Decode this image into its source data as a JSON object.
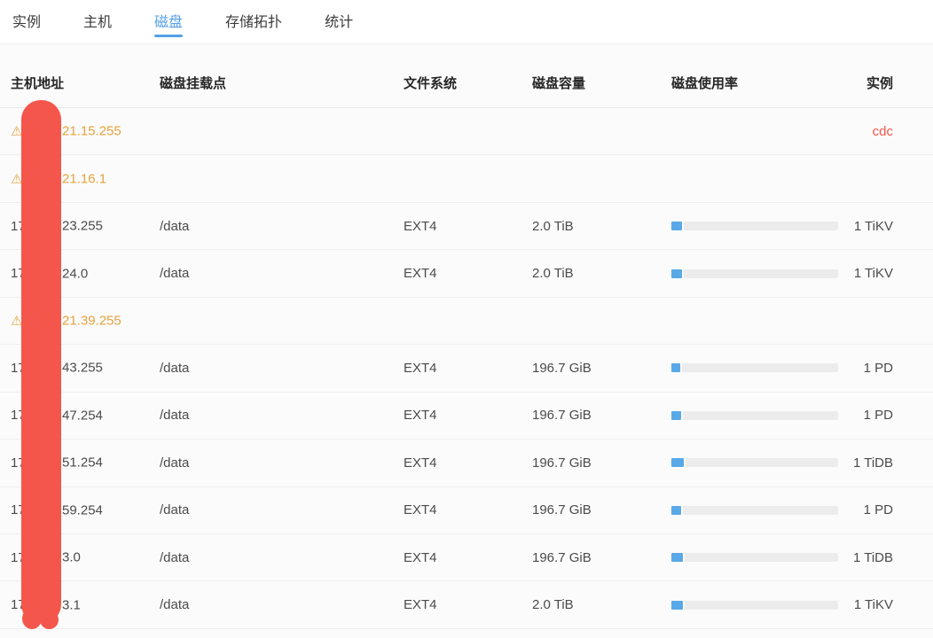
{
  "tabs": {
    "items": [
      {
        "label": "实例",
        "active": false
      },
      {
        "label": "主机",
        "active": false
      },
      {
        "label": "磁盘",
        "active": true
      },
      {
        "label": "存储拓扑",
        "active": false
      },
      {
        "label": "统计",
        "active": false
      }
    ]
  },
  "table": {
    "columns": {
      "host": "主机地址",
      "mount": "磁盘挂载点",
      "fs": "文件系统",
      "capacity": "磁盘容量",
      "usage": "磁盘使用率",
      "instance": "实例"
    },
    "rows": [
      {
        "warning": true,
        "host_prefix": "",
        "host_suffix": "21.15.255",
        "mount": "",
        "fs": "",
        "capacity": "",
        "usage_pct": null,
        "instance": "cdc",
        "instance_red": true
      },
      {
        "warning": true,
        "host_prefix": "",
        "host_suffix": "21.16.1",
        "mount": "",
        "fs": "",
        "capacity": "",
        "usage_pct": null,
        "instance": "",
        "instance_red": false
      },
      {
        "warning": false,
        "host_prefix": "17",
        "host_suffix": "23.255",
        "mount": "/data",
        "fs": "EXT4",
        "capacity": "2.0 TiB",
        "usage_pct": 6.5,
        "instance": "1 TiKV",
        "instance_red": false
      },
      {
        "warning": false,
        "host_prefix": "17",
        "host_suffix": "24.0",
        "mount": "/data",
        "fs": "EXT4",
        "capacity": "2.0 TiB",
        "usage_pct": 6.5,
        "instance": "1 TiKV",
        "instance_red": false
      },
      {
        "warning": true,
        "host_prefix": "",
        "host_suffix": "21.39.255",
        "mount": "",
        "fs": "",
        "capacity": "",
        "usage_pct": null,
        "instance": "",
        "instance_red": false
      },
      {
        "warning": false,
        "host_prefix": "17",
        "host_suffix": "43.255",
        "mount": "/data",
        "fs": "EXT4",
        "capacity": "196.7 GiB",
        "usage_pct": 5.5,
        "instance": "1 PD",
        "instance_red": false
      },
      {
        "warning": false,
        "host_prefix": "17",
        "host_suffix": "47.254",
        "mount": "/data",
        "fs": "EXT4",
        "capacity": "196.7 GiB",
        "usage_pct": 6,
        "instance": "1 PD",
        "instance_red": false
      },
      {
        "warning": false,
        "host_prefix": "17",
        "host_suffix": "51.254",
        "mount": "/data",
        "fs": "EXT4",
        "capacity": "196.7 GiB",
        "usage_pct": 7.5,
        "instance": "1 TiDB",
        "instance_red": false
      },
      {
        "warning": false,
        "host_prefix": "17",
        "host_suffix": "59.254",
        "mount": "/data",
        "fs": "EXT4",
        "capacity": "196.7 GiB",
        "usage_pct": 6,
        "instance": "1 PD",
        "instance_red": false
      },
      {
        "warning": false,
        "host_prefix": "17",
        "host_suffix": "3.0",
        "mount": "/data",
        "fs": "EXT4",
        "capacity": "196.7 GiB",
        "usage_pct": 7,
        "instance": "1 TiDB",
        "instance_red": false
      },
      {
        "warning": false,
        "host_prefix": "17",
        "host_suffix": "3.1",
        "mount": "/data",
        "fs": "EXT4",
        "capacity": "2.0 TiB",
        "usage_pct": 7,
        "instance": "1 TiKV",
        "instance_red": false
      }
    ]
  },
  "icons": {
    "warning": "⚠"
  },
  "colors": {
    "tab_active": "#549fe8",
    "usage_bar_fill": "#59a9e8",
    "usage_bar_track": "#ececec",
    "warning_orange": "#e6a23c",
    "instance_red": "#f5564b",
    "redaction_red": "#f5564b"
  }
}
